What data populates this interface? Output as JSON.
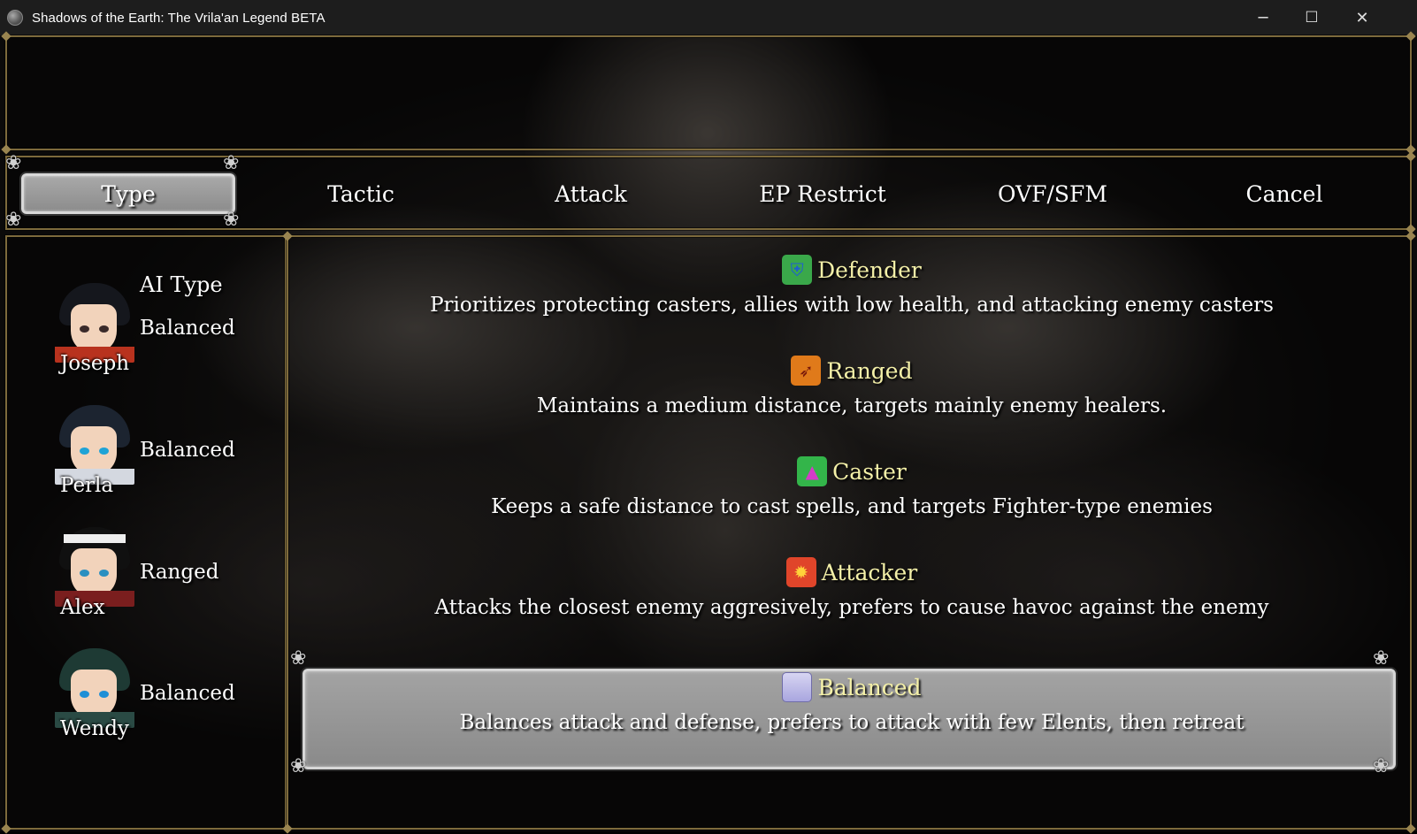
{
  "window": {
    "title": "Shadows of the Earth: The Vrila'an Legend BETA",
    "minimize_glyph": "─",
    "maximize_glyph": "☐",
    "close_glyph": "✕"
  },
  "tabs": [
    {
      "label": "Type",
      "selected": true
    },
    {
      "label": "Tactic",
      "selected": false
    },
    {
      "label": "Attack",
      "selected": false
    },
    {
      "label": "EP Restrict",
      "selected": false
    },
    {
      "label": "OVF/SFM",
      "selected": false
    },
    {
      "label": "Cancel",
      "selected": false
    }
  ],
  "party": {
    "header": "AI Type",
    "members": [
      {
        "name": "Joseph",
        "ai_type": "Balanced"
      },
      {
        "name": "Perla",
        "ai_type": "Balanced"
      },
      {
        "name": "Alex",
        "ai_type": "Ranged"
      },
      {
        "name": "Wendy",
        "ai_type": "Balanced"
      }
    ]
  },
  "ai_options": [
    {
      "name": "Defender",
      "icon": "shield-icon",
      "icon_color": "#3aa84a",
      "description": "Prioritizes protecting casters, allies with low health, and attacking enemy casters"
    },
    {
      "name": "Ranged",
      "icon": "bow-icon",
      "icon_color": "#e07a1a",
      "description": "Maintains a medium distance, targets mainly enemy healers."
    },
    {
      "name": "Caster",
      "icon": "wizard-hat-icon",
      "icon_color": "#33b54a",
      "description": "Keeps a safe distance to cast spells, and targets Fighter-type enemies"
    },
    {
      "name": "Attacker",
      "icon": "fire-icon",
      "icon_color": "#e0452a",
      "description": "Attacks the closest enemy aggresively, prefers to cause havoc against the enemy"
    },
    {
      "name": "Balanced",
      "icon": "balance-icon",
      "icon_color": "#b9b6e8",
      "description": "Balances attack and defense, prefers to attack with few Elents, then retreat",
      "selected": true
    }
  ],
  "colors": {
    "frame_gold": "#7d6a3c",
    "option_name_yellow": "#f4f0a8",
    "selection_gray": "#9a9a9a"
  }
}
